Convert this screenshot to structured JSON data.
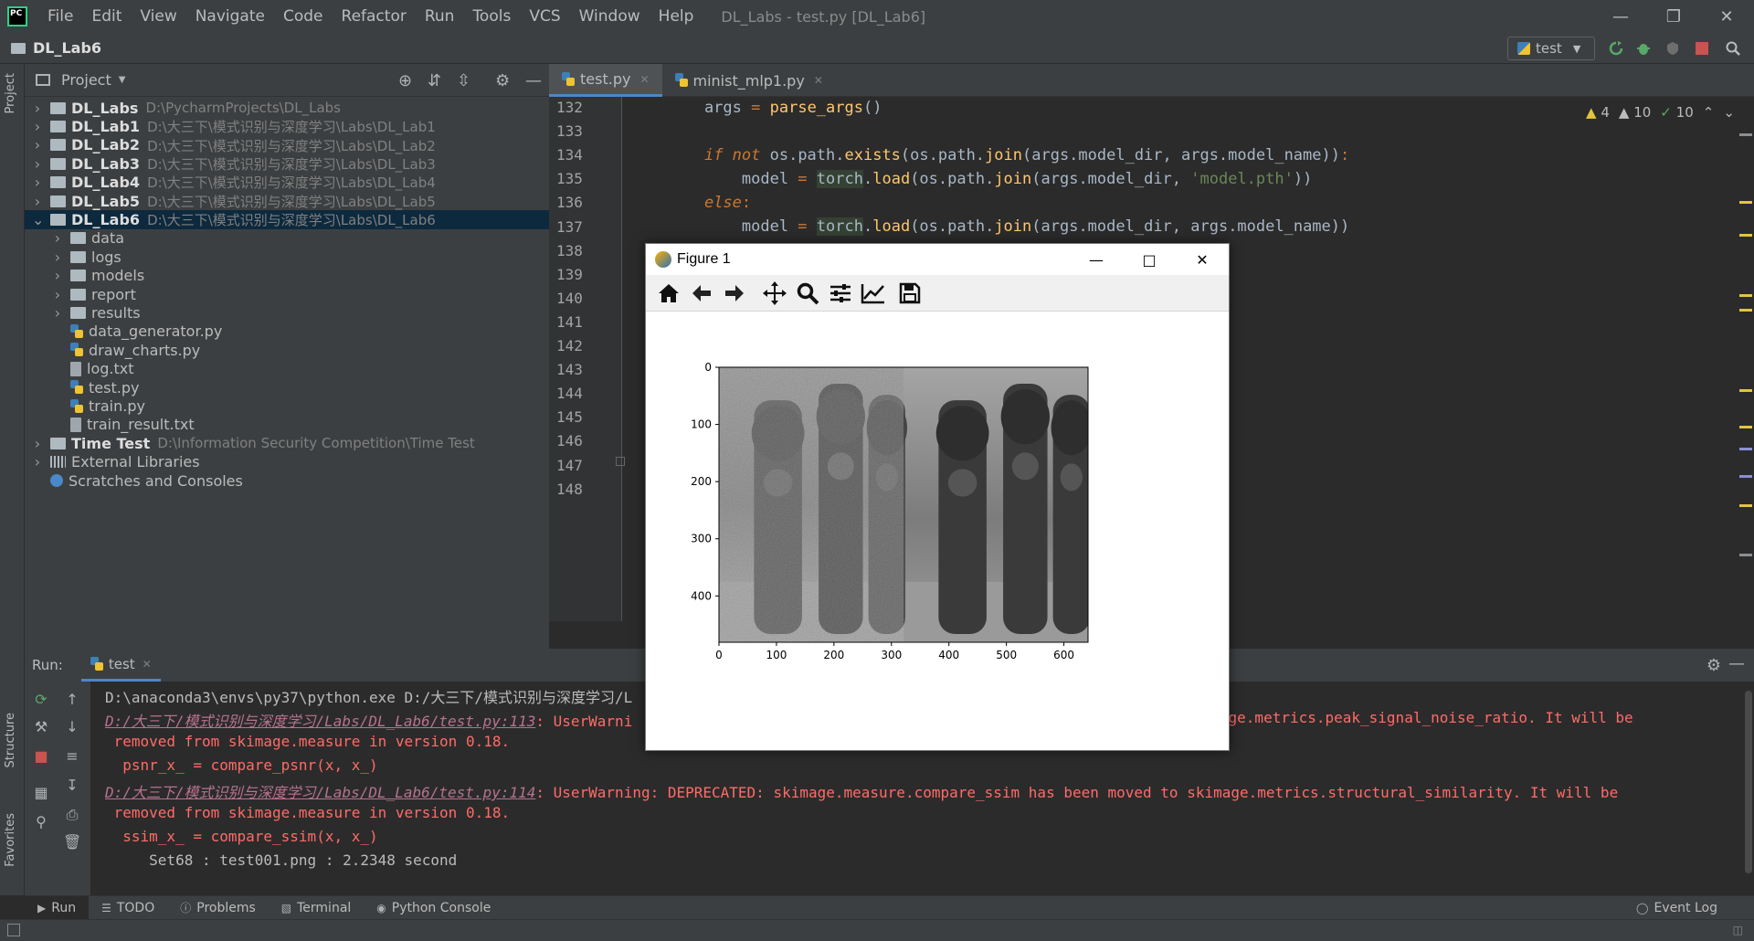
{
  "menu": {
    "items": [
      "File",
      "Edit",
      "View",
      "Navigate",
      "Code",
      "Refactor",
      "Run",
      "Tools",
      "VCS",
      "Window",
      "Help"
    ],
    "window_title": "DL_Labs - test.py [DL_Lab6]"
  },
  "navbar": {
    "project": "DL_Lab6",
    "run_config": "test"
  },
  "side_tabs": {
    "project": "Project",
    "structure": "Structure",
    "favorites": "Favorites"
  },
  "project_panel": {
    "title": "Project",
    "tree": [
      {
        "name": "DL_Labs",
        "path": "D:\\PycharmProjects\\DL_Labs",
        "type": "folder",
        "expanded": false,
        "bold": true
      },
      {
        "name": "DL_Lab1",
        "path": "D:\\大三下\\模式识别与深度学习\\Labs\\DL_Lab1",
        "type": "folder",
        "expanded": false,
        "bold": true
      },
      {
        "name": "DL_Lab2",
        "path": "D:\\大三下\\模式识别与深度学习\\Labs\\DL_Lab2",
        "type": "folder",
        "expanded": false,
        "bold": true
      },
      {
        "name": "DL_Lab3",
        "path": "D:\\大三下\\模式识别与深度学习\\Labs\\DL_Lab3",
        "type": "folder",
        "expanded": false,
        "bold": true
      },
      {
        "name": "DL_Lab4",
        "path": "D:\\大三下\\模式识别与深度学习\\Labs\\DL_Lab4",
        "type": "folder",
        "expanded": false,
        "bold": true
      },
      {
        "name": "DL_Lab5",
        "path": "D:\\大三下\\模式识别与深度学习\\Labs\\DL_Lab5",
        "type": "folder",
        "expanded": false,
        "bold": true
      },
      {
        "name": "DL_Lab6",
        "path": "D:\\大三下\\模式识别与深度学习\\Labs\\DL_Lab6",
        "type": "folder",
        "expanded": true,
        "bold": true,
        "selected": true
      },
      {
        "name": "data",
        "path": "",
        "type": "folder",
        "depth": 1
      },
      {
        "name": "logs",
        "path": "",
        "type": "folder",
        "depth": 1
      },
      {
        "name": "models",
        "path": "",
        "type": "folder",
        "depth": 1
      },
      {
        "name": "report",
        "path": "",
        "type": "folder",
        "depth": 1
      },
      {
        "name": "results",
        "path": "",
        "type": "folder",
        "depth": 1
      },
      {
        "name": "data_generator.py",
        "path": "",
        "type": "py",
        "depth": 1
      },
      {
        "name": "draw_charts.py",
        "path": "",
        "type": "py",
        "depth": 1
      },
      {
        "name": "log.txt",
        "path": "",
        "type": "txt",
        "depth": 1
      },
      {
        "name": "test.py",
        "path": "",
        "type": "py",
        "depth": 1
      },
      {
        "name": "train.py",
        "path": "",
        "type": "py",
        "depth": 1
      },
      {
        "name": "train_result.txt",
        "path": "",
        "type": "txt",
        "depth": 1
      },
      {
        "name": "Time Test",
        "path": "D:\\Information Security Competition\\Time Test",
        "type": "folder",
        "expanded": false,
        "bold": true
      },
      {
        "name": "External Libraries",
        "path": "",
        "type": "lib",
        "expanded": false
      },
      {
        "name": "Scratches and Consoles",
        "path": "",
        "type": "scratch"
      }
    ]
  },
  "editor": {
    "tabs": [
      {
        "label": "test.py",
        "active": true
      },
      {
        "label": "minist_mlp1.py",
        "active": false
      }
    ],
    "line_numbers": [
      "132",
      "133",
      "134",
      "135",
      "136",
      "137",
      "138",
      "139",
      "140",
      "141",
      "142",
      "143",
      "144",
      "145",
      "146",
      "147",
      "148"
    ],
    "inspections": {
      "warnings": "4",
      "weak_warnings": "10",
      "ok": "10"
    }
  },
  "figure": {
    "title": "Figure 1",
    "y_ticks": [
      "0",
      "100",
      "200",
      "300",
      "400"
    ],
    "x_ticks": [
      "0",
      "100",
      "200",
      "300",
      "400",
      "500",
      "600"
    ]
  },
  "run_panel": {
    "label": "Run:",
    "tab": "test",
    "console": {
      "cmd": "D:\\anaconda3\\envs\\py37\\python.exe D:/大三下/模式识别与深度学习/L",
      "link1": "D:/大三下/模式识别与深度学习/Labs/DL_Lab6/test.py:113",
      "warn1_head": ": UserWarni",
      "warn1_tail": "kimage.metrics.peak_signal_noise_ratio. It will be",
      "removed1": " removed from skimage.measure in version 0.18.",
      "code1": "  psnr_x_ = compare_psnr(x, x_)",
      "link2": "D:/大三下/模式识别与深度学习/Labs/DL_Lab6/test.py:114",
      "warn2": ": UserWarning: DEPRECATED: skimage.measure.compare_ssim has been moved to skimage.metrics.structural_similarity. It will be",
      "removed2": " removed from skimage.measure in version 0.18.",
      "code2": "  ssim_x_ = compare_ssim(x, x_)",
      "result": "     Set68 : test001.png : 2.2348 second"
    }
  },
  "bottom_tabs": {
    "run": "Run",
    "todo": "TODO",
    "problems": "Problems",
    "terminal": "Terminal",
    "python_console": "Python Console",
    "event_log": "Event Log"
  },
  "colors": {
    "bg": "#2b2b2b",
    "panel": "#3c3f41",
    "selection": "#0d293e",
    "accent": "#4a88c7",
    "error_text": "#ff6b68",
    "link_text": "#b6738f"
  }
}
